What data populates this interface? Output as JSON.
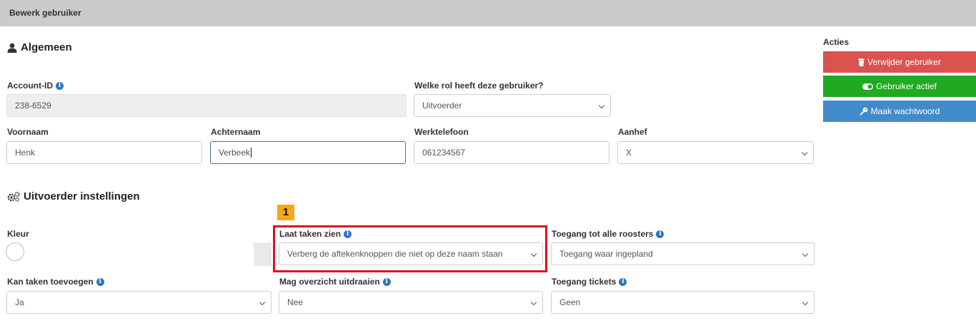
{
  "window": {
    "title": "Bewerk gebruiker"
  },
  "sections": {
    "general": "Algemeen",
    "executor": "Uitvoerder instellingen"
  },
  "actions": {
    "title": "Acties",
    "delete": "Verwijder gebruiker",
    "active": "Gebruiker actief",
    "password": "Maak wachtwoord"
  },
  "form": {
    "account_id": {
      "label": "Account-ID",
      "value": "238-6529"
    },
    "role": {
      "label": "Welke rol heeft deze gebruiker?",
      "value": "Uitvoerder"
    },
    "first_name": {
      "label": "Voornaam",
      "value": "Henk"
    },
    "last_name": {
      "label": "Achternaam",
      "value": "Verbeek"
    },
    "work_phone": {
      "label": "Werktelefoon",
      "value": "061234567"
    },
    "salutation": {
      "label": "Aanhef",
      "value": "X"
    },
    "color": {
      "label": "Kleur"
    },
    "show_tasks": {
      "label": "Laat taken zien",
      "value": "Verberg de aftekenknoppen die niet op deze naam staan"
    },
    "schedule_access": {
      "label": "Toegang tot alle roosters",
      "value": "Toegang waar ingepland"
    },
    "can_add_tasks": {
      "label": "Kan taken toevoegen",
      "value": "Ja"
    },
    "print_overview": {
      "label": "Mag overzicht uitdraaien",
      "value": "Nee"
    },
    "ticket_access": {
      "label": "Toegang tickets",
      "value": "Geen"
    }
  },
  "annotation": {
    "badge": "1"
  },
  "colors": {
    "delete": "#d9534f",
    "active": "#1faa1f",
    "password": "#428bca",
    "highlight": "#e0101a",
    "badge": "#f3a719"
  }
}
